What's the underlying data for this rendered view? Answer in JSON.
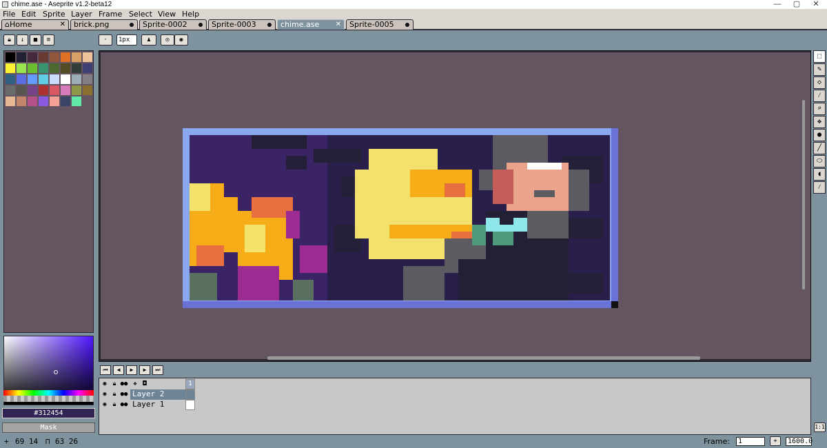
{
  "window": {
    "title": "chime.ase - Aseprite v1.2-beta12",
    "minimize": "—",
    "maximize": "▢",
    "close": "✕"
  },
  "menu": [
    "File",
    "Edit",
    "Sprite",
    "Layer",
    "Frame",
    "Select",
    "View",
    "Help"
  ],
  "tabs": [
    {
      "label": "Home",
      "icon": "home-icon",
      "state": "close"
    },
    {
      "label": "brick.png",
      "state": "modified"
    },
    {
      "label": "Sprite-0002",
      "state": "modified"
    },
    {
      "label": "Sprite-0003",
      "state": "modified"
    },
    {
      "label": "chime.ase",
      "state": "close",
      "active": true
    },
    {
      "label": "Sprite-0005",
      "state": "modified"
    }
  ],
  "context_bar": {
    "brush_size": "1px"
  },
  "palette": {
    "colors": [
      "#000000",
      "#222034",
      "#45283c",
      "#663931",
      "#8f563b",
      "#df7126",
      "#d9a066",
      "#eec39a",
      "#fbf236",
      "#99e550",
      "#6abe30",
      "#37946e",
      "#4b692f",
      "#524b24",
      "#323c39",
      "#3f3f74",
      "#306082",
      "#5b6ee1",
      "#639bff",
      "#5fcde4",
      "#cbdbfc",
      "#ffffff",
      "#9badb7",
      "#847e87",
      "#696a6a",
      "#595652",
      "#76428a",
      "#ac3232",
      "#d95763",
      "#d77bba",
      "#8f974a",
      "#8a6f30",
      "#e8b796",
      "#c28569",
      "#b55088",
      "#8b5ae0",
      "#f5a097",
      "#3a4466",
      "#62e8a8"
    ],
    "palette_hex": "#312454"
  },
  "color_panel": {
    "hex": "#312454",
    "mask_label": "Mask"
  },
  "timeline": {
    "frame_number": "1",
    "layers": [
      {
        "name": "Layer 2",
        "selected": true
      },
      {
        "name": "Layer 1",
        "selected": false
      }
    ]
  },
  "status": {
    "cursor_pos": "69 14",
    "sprite_size": "63 26",
    "frame_label": "Frame:",
    "frame_value": "1",
    "zoom": "1600.0"
  },
  "colors": {
    "background": "#7e939d",
    "canvas_bg": "#645560",
    "sprite_border": "#8aa8f0"
  }
}
